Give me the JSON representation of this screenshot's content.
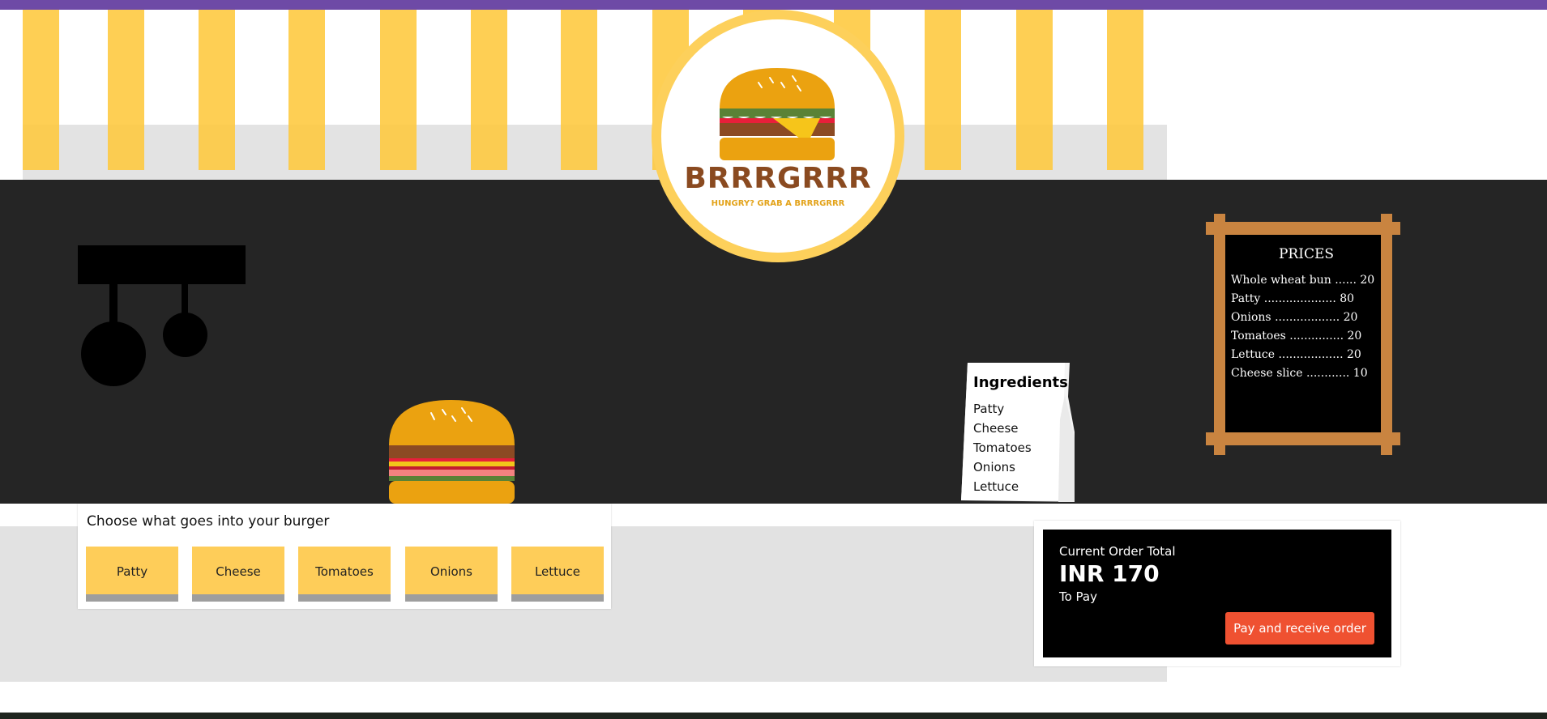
{
  "brand": {
    "name": "BRRRGRRR",
    "tagline": "HUNGRY? GRAB A BRRRGRRR"
  },
  "colors": {
    "header_accent": "#6e4aa6",
    "awning_stripe": "#fec83c",
    "wall": "#252525",
    "button": "#fecd59",
    "pay_button": "#ef5131",
    "board_frame": "#c98440",
    "brand_text": "#8a4a20"
  },
  "price_board": {
    "title": "PRICES",
    "items": [
      {
        "name": "Whole wheat bun",
        "dots": "......",
        "price": "20"
      },
      {
        "name": "Patty",
        "dots": "....................",
        "price": "80"
      },
      {
        "name": "Onions",
        "dots": "..................",
        "price": "20"
      },
      {
        "name": "Tomatoes",
        "dots": "...............",
        "price": "20"
      },
      {
        "name": "Lettuce",
        "dots": "..................",
        "price": "20"
      },
      {
        "name": "Cheese slice",
        "dots": "............",
        "price": "10"
      }
    ]
  },
  "ingredients_card": {
    "title": "Ingredients",
    "items": [
      "Patty",
      "Cheese",
      "Tomatoes",
      "Onions",
      "Lettuce"
    ]
  },
  "chooser": {
    "title": "Choose what goes into your burger",
    "buttons": [
      "Patty",
      "Cheese",
      "Tomatoes",
      "Onions",
      "Lettuce"
    ]
  },
  "order": {
    "label": "Current Order Total",
    "total": "INR 170",
    "sub": "To Pay",
    "pay_label": "Pay and receive order"
  },
  "icons": {
    "logo": "burger-logo-icon",
    "burger": "burger-icon",
    "pans": "hanging-pans-icon"
  }
}
